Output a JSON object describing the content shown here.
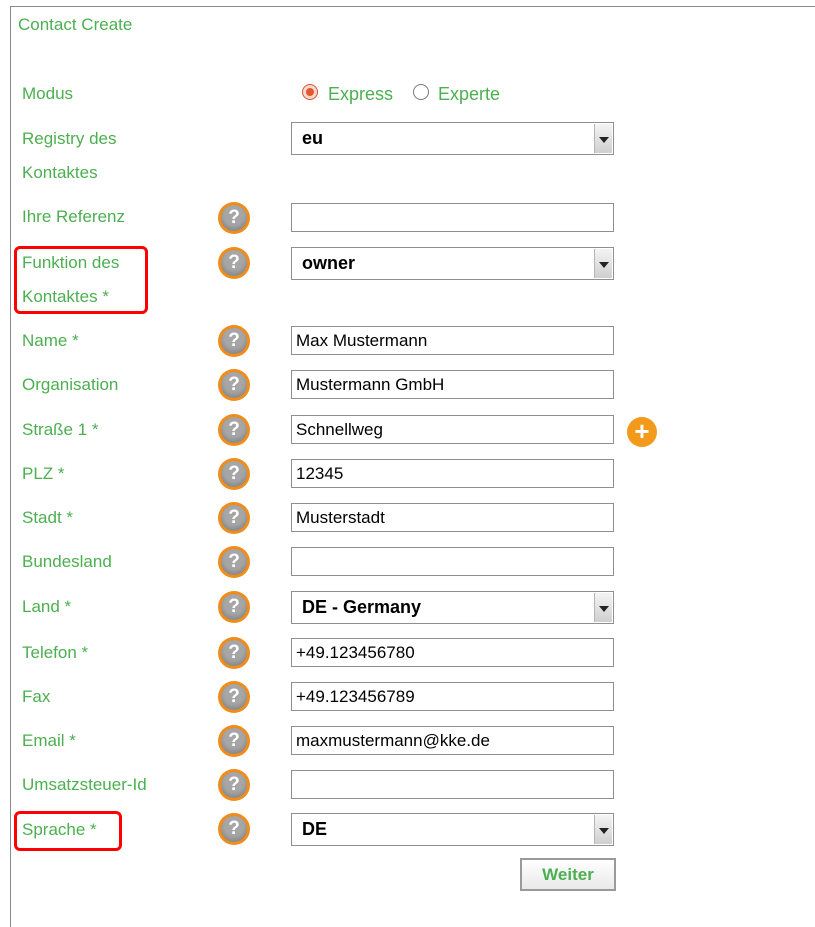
{
  "form": {
    "title": "Contact Create",
    "modus": {
      "label": "Modus",
      "options": [
        "Express",
        "Experte"
      ],
      "selected": "Express"
    },
    "registry": {
      "label_line1": "Registry des",
      "label_line2": "Kontaktes",
      "value": "eu"
    },
    "referenz": {
      "label": "Ihre Referenz",
      "value": ""
    },
    "funktion": {
      "label_line1": "Funktion des",
      "label_line2": "Kontaktes *",
      "value": "owner"
    },
    "name": {
      "label": "Name *",
      "value": "Max Mustermann"
    },
    "organisation": {
      "label": "Organisation",
      "value": "Mustermann GmbH"
    },
    "strasse": {
      "label": "Straße 1 *",
      "value": "Schnellweg"
    },
    "plz": {
      "label": "PLZ *",
      "value": "12345"
    },
    "stadt": {
      "label": "Stadt *",
      "value": "Musterstadt"
    },
    "bundesland": {
      "label": "Bundesland",
      "value": ""
    },
    "land": {
      "label": "Land *",
      "value": "DE - Germany"
    },
    "telefon": {
      "label": "Telefon *",
      "value": "+49.123456780"
    },
    "fax": {
      "label": "Fax",
      "value": "+49.123456789"
    },
    "email": {
      "label": "Email *",
      "value": "maxmustermann@kke.de"
    },
    "ust": {
      "label": "Umsatzsteuer-Id",
      "value": ""
    },
    "sprache": {
      "label": "Sprache *",
      "value": "DE"
    },
    "submit_label": "Weiter",
    "help_glyph": "?",
    "add_glyph": "+"
  },
  "colors": {
    "label": "#4caf50",
    "help": "#f18b1a",
    "highlight": "#ff0000"
  }
}
